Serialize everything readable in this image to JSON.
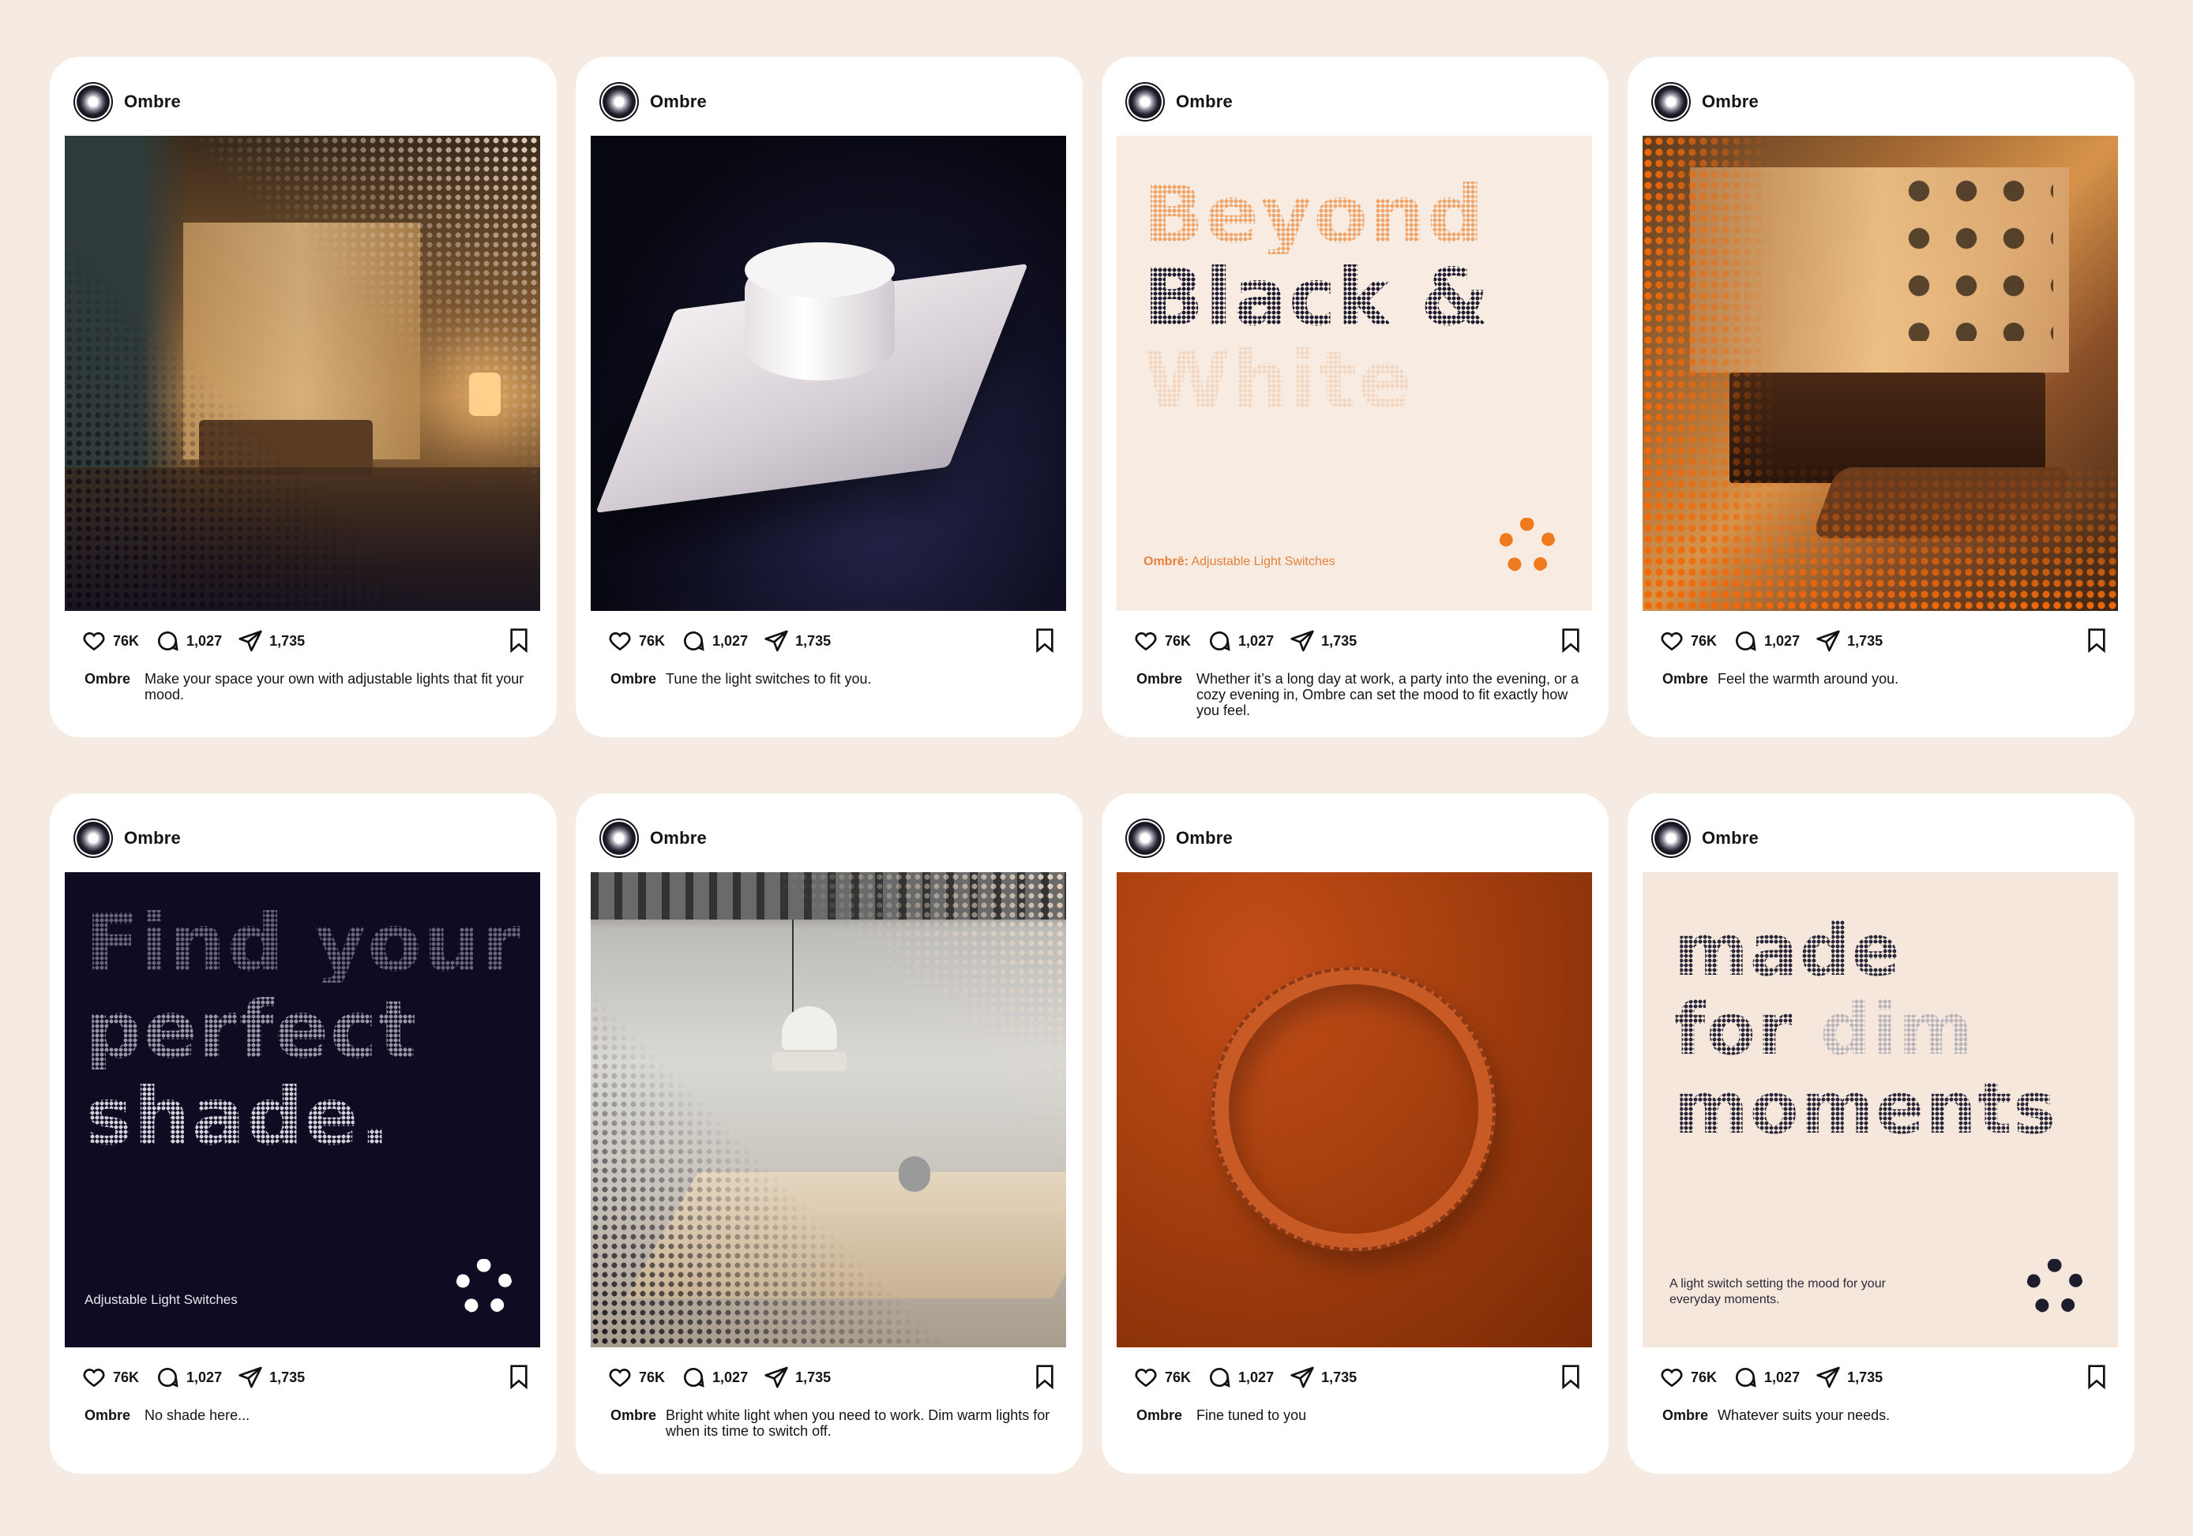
{
  "username": "Ombre",
  "stats": {
    "likes": "76K",
    "comments": "1,027",
    "shares": "1,735"
  },
  "icons": {
    "like": "heart-icon",
    "comment": "comment-bubble-icon",
    "share": "paper-plane-icon",
    "save": "bookmark-icon"
  },
  "colors": {
    "background": "#f6ebe3",
    "accent_orange": "#f07a1e",
    "navy": "#0d0c22",
    "cream": "#f8ebe1"
  },
  "posts": [
    {
      "caption": "Make your space your own with adjustable lights that fit your mood.",
      "image": "living-room-halftone"
    },
    {
      "caption": "Tune the light switches to fit you.",
      "image": "white-dial-switch"
    },
    {
      "caption": "Whether it’s a long day at work, a party into the evening, or a cozy evening in, Ombre can set the mood to fit exactly how you feel.",
      "image": "text-post",
      "headline": [
        "Beyond",
        "Black",
        "&",
        "White"
      ],
      "tagline_brand": "Ombrē:",
      "tagline": "Adjustable Light Switches"
    },
    {
      "caption": "Feel the warmth around you.",
      "image": "warm-sideboard-halftone"
    },
    {
      "caption": "No shade here...",
      "image": "text-post",
      "headline": [
        "Find your",
        "perfect",
        "shade."
      ],
      "tagline": "Adjustable Light Switches"
    },
    {
      "caption": "Bright white light when you need to work. Dim warm lights for when its time to switch off.",
      "image": "desk-pendant-halftone"
    },
    {
      "caption": "Fine tuned to you",
      "image": "orange-ring-switch"
    },
    {
      "caption": "Whatever suits your needs.",
      "image": "text-post",
      "headline": [
        "made",
        "for",
        "dim",
        "moments"
      ],
      "tagline": "A light switch setting the mood for your everyday moments."
    }
  ]
}
